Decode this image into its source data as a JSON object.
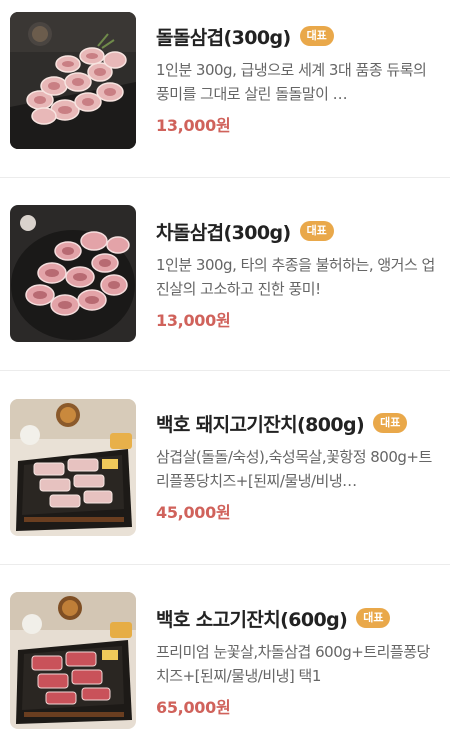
{
  "items": [
    {
      "name": "돌돌삼겹(300g)",
      "badge": "대표",
      "description": "1인분 300g, 급냉으로 세계 3대 품종 듀록의 풍미를 그대로 살린 돌돌말이 …",
      "price": "13,000원",
      "image": "rolled-pork-belly-photo"
    },
    {
      "name": "차돌삼겹(300g)",
      "badge": "대표",
      "description": "1인분 300g, 타의 추종을 불허하는, 앵거스 업진살의 고소하고 진한 풍미!",
      "price": "13,000원",
      "image": "brisket-rolls-photo"
    },
    {
      "name": "백호 돼지고기잔치(800g)",
      "badge": "대표",
      "description": "삼겹살(돌돌/숙성),숙성목살,꽃항정 800g+트리플퐁당치즈+[된찌/물냉/비냉…",
      "price": "45,000원",
      "image": "pork-platter-photo"
    },
    {
      "name": "백호 소고기잔치(600g)",
      "badge": "대표",
      "description": "프리미엄 눈꽃살,차돌삼겹 600g+트리플퐁당치즈+[된찌/물냉/비냉] 택1",
      "price": "65,000원",
      "image": "beef-platter-photo"
    }
  ],
  "colors": {
    "badge": "#e9a84a",
    "price": "#d0625b",
    "title": "#222222",
    "description": "#666666"
  }
}
